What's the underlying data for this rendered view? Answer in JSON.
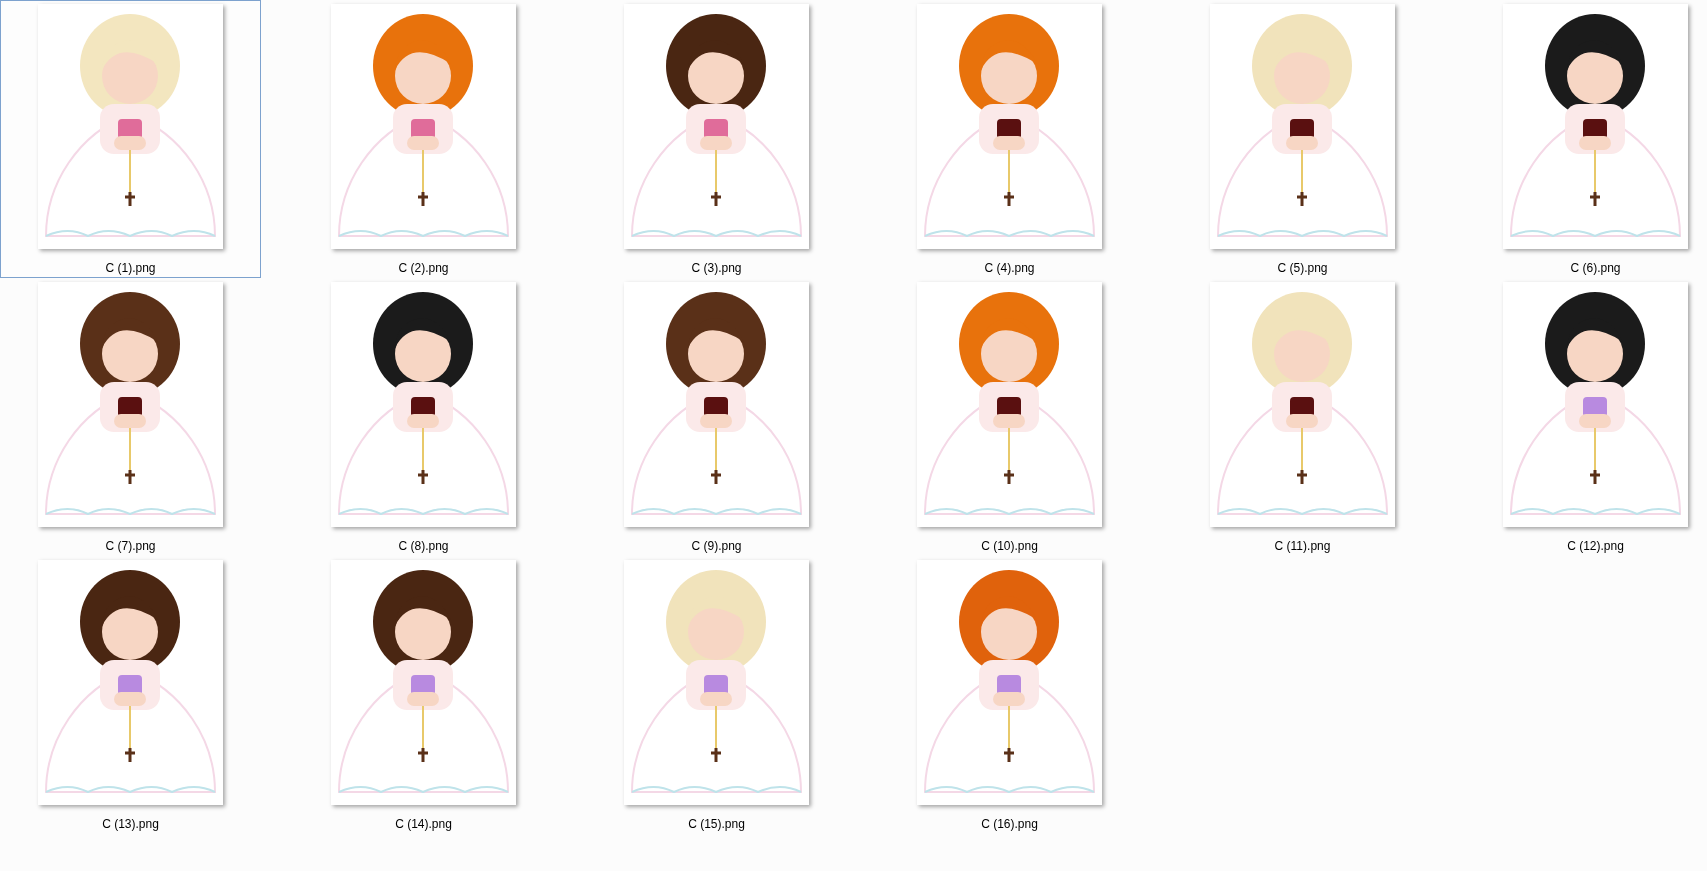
{
  "files": [
    {
      "label": "C (1).png",
      "selected": true
    },
    {
      "label": "C (2).png",
      "selected": false
    },
    {
      "label": "C (3).png",
      "selected": false
    },
    {
      "label": "C (4).png",
      "selected": false
    },
    {
      "label": "C (5).png",
      "selected": false
    },
    {
      "label": "C (6).png",
      "selected": false
    },
    {
      "label": "C (7).png",
      "selected": false
    },
    {
      "label": "C (8).png",
      "selected": false
    },
    {
      "label": "C (9).png",
      "selected": false
    },
    {
      "label": "C (10).png",
      "selected": false
    },
    {
      "label": "C (11).png",
      "selected": false
    },
    {
      "label": "C (12).png",
      "selected": false
    },
    {
      "label": "C (13).png",
      "selected": false
    },
    {
      "label": "C (14).png",
      "selected": false
    },
    {
      "label": "C (15).png",
      "selected": false
    },
    {
      "label": "C (16).png",
      "selected": false
    }
  ]
}
